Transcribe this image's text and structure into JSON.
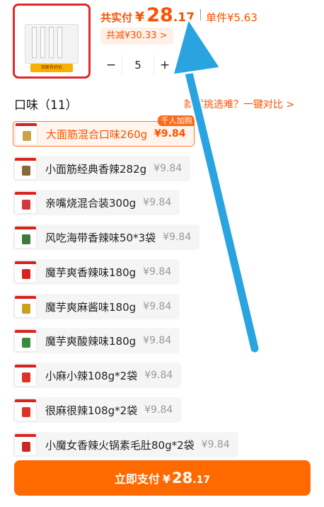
{
  "header": {
    "total_label": "共实付",
    "currency": "¥",
    "total_int": "28",
    "total_dec": ".17",
    "unit_label": "单件¥5.63",
    "savings": "共减¥30.33 >",
    "quantity": "5",
    "minus": "−",
    "plus": "+",
    "thumb_tag": "到家有好价"
  },
  "section": {
    "title": "口味（11）",
    "compare_link": "款式挑选难？一键对比 >"
  },
  "options": [
    {
      "name": "大面筋混合口味260g",
      "price": "¥9.84",
      "badge": "千人加购",
      "selected": true,
      "mark_color": "#c9a24a"
    },
    {
      "name": "小面筋经典香辣282g",
      "price": "¥9.84",
      "badge": "",
      "selected": false,
      "mark_color": "#8b6a3a"
    },
    {
      "name": "亲嘴烧混合装300g",
      "price": "¥9.84",
      "badge": "",
      "selected": false,
      "mark_color": "#d2383a"
    },
    {
      "name": "风吃海带香辣味50*3袋",
      "price": "¥9.84",
      "badge": "",
      "selected": false,
      "mark_color": "#3d7a3a"
    },
    {
      "name": "魔芋爽香辣味180g",
      "price": "¥9.84",
      "badge": "",
      "selected": false,
      "mark_color": "#d8231c"
    },
    {
      "name": "魔芋爽麻酱味180g",
      "price": "¥9.84",
      "badge": "",
      "selected": false,
      "mark_color": "#c9a020"
    },
    {
      "name": "魔芋爽酸辣味180g",
      "price": "¥9.84",
      "badge": "",
      "selected": false,
      "mark_color": "#3b8a3b"
    },
    {
      "name": "小麻小辣108g*2袋",
      "price": "¥9.84",
      "badge": "",
      "selected": false,
      "mark_color": "#e03028"
    },
    {
      "name": "很麻很辣108g*2袋",
      "price": "¥9.84",
      "badge": "",
      "selected": false,
      "mark_color": "#e03028"
    },
    {
      "name": "小魔女香辣火锅素毛肚80g*2袋",
      "price": "¥9.84",
      "badge": "",
      "selected": false,
      "mark_color": "#c82a20"
    }
  ],
  "pay_button": {
    "label": "立即支付",
    "currency": "¥",
    "int": "28",
    "dec": ".17"
  },
  "colors": {
    "accent": "#ff5000",
    "pay_bg": "#ff6a00",
    "annotation_arrow": "#2aa4e0"
  }
}
